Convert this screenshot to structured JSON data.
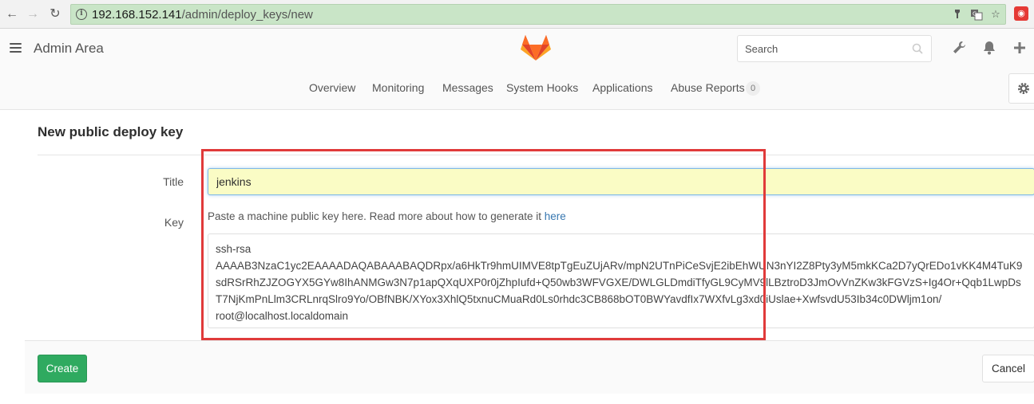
{
  "browser": {
    "url_host": "192.168.152.141",
    "url_path": "/admin/deploy_keys/new"
  },
  "header": {
    "title": "Admin Area",
    "search_placeholder": "Search"
  },
  "subnav": {
    "items": [
      {
        "label": "Overview"
      },
      {
        "label": "Monitoring"
      },
      {
        "label": "Messages"
      },
      {
        "label": "System Hooks"
      },
      {
        "label": "Applications"
      },
      {
        "label": "Abuse Reports",
        "badge": "0"
      }
    ]
  },
  "form": {
    "page_title": "New public deploy key",
    "title_label": "Title",
    "title_value": "jenkins",
    "key_label": "Key",
    "key_help": "Paste a machine public key here. Read more about how to generate it ",
    "key_help_link": "here",
    "key_value": "ssh-rsa\nAAAAB3NzaC1yc2EAAAADAQABAAABAQDRpx/a6HkTr9hmUIMVE8tpTgEuZUjARv/mpN2UTnPiCeSvjE2ibEhWUN3nYI2Z8Pty3yM5mkKCa2D7yQrEDo1vKK4M4TuK9sdRSrRhZJZOGYX5GYw8IhANMGw3N7p1apQXqUXP0r0jZhpIufd+Q50wb3WFVGXE/DWLGLDmdiTfyGL9CyMV9lLBztroD3JmOvVnZKw3kFGVzS+Ig4Or+Qqb1LwpDsT7NjKmPnLlm3CRLnrqSlro9Yo/OBfNBK/XYox3XhlQ5txnuCMuaRd0Ls0rhdc3CB868bOT0BWYavdfIx7WXfvLg3xd0iUslae+XwfsvdU53Ib34c0DWljm1on/\nroot@localhost.localdomain",
    "create_label": "Create",
    "cancel_label": "Cancel"
  },
  "colors": {
    "create_button": "#2faa60",
    "highlight": "#e03a3a",
    "link": "#3777b0"
  }
}
